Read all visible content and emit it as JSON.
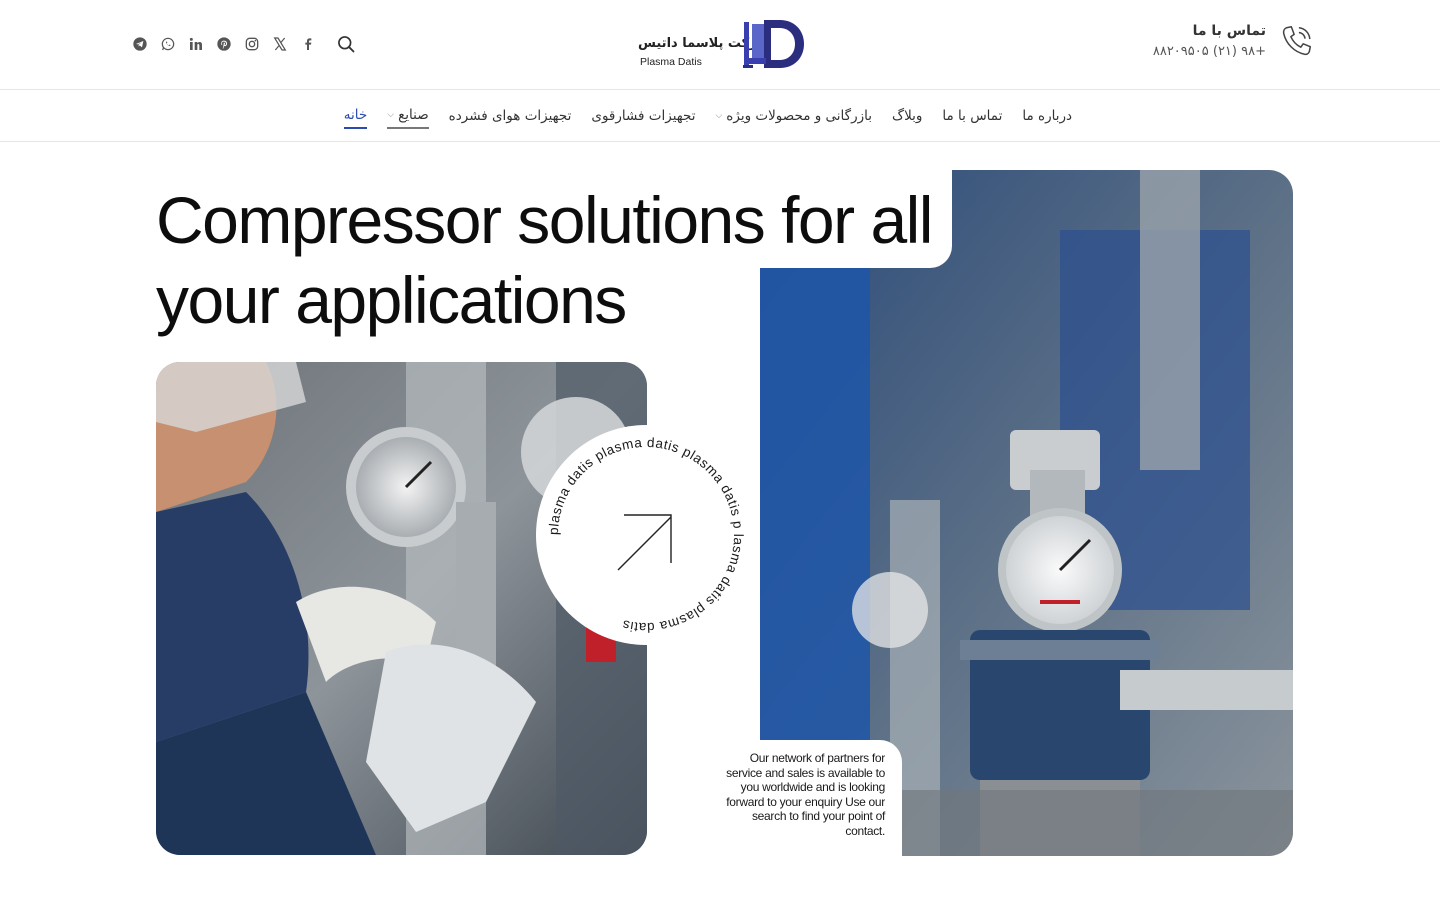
{
  "header": {
    "socials": [
      {
        "name": "telegram-icon"
      },
      {
        "name": "whatsapp-icon"
      },
      {
        "name": "linkedin-icon"
      },
      {
        "name": "pinterest-icon"
      },
      {
        "name": "instagram-icon"
      },
      {
        "name": "x-icon"
      },
      {
        "name": "facebook-icon"
      }
    ],
    "logo": {
      "fa_text": "شرکت پلاسما داتیس",
      "en_text": "Plasma Datis",
      "brand_color": "#2b2d7f"
    },
    "contact": {
      "title": "تماس با ما",
      "phone": "+۹۸ (۲۱) ۸۸۲۰۹۵۰۵"
    }
  },
  "nav": {
    "items": [
      {
        "label": "خانه",
        "state": "active"
      },
      {
        "label": "صنایع",
        "has_dropdown": true
      },
      {
        "label": "تجهیزات هوای فشرده"
      },
      {
        "label": "تجهیزات فشارقوی"
      },
      {
        "label": "بازرگانی و محصولات ویژه",
        "has_dropdown": true
      },
      {
        "label": "وبلاگ"
      },
      {
        "label": "تماس با ما"
      },
      {
        "label": "درباره ما"
      }
    ],
    "active_color": "#2b4cae"
  },
  "hero": {
    "title": "Compressor solutions for all your applications",
    "badge_text": "plasma datis plasma datis plasma datis p lasma datis plasma datis",
    "side_note": "Our network of partners for service and sales is available to you worldwide and is looking forward to your enquiry Use our search to find your point of contact."
  }
}
